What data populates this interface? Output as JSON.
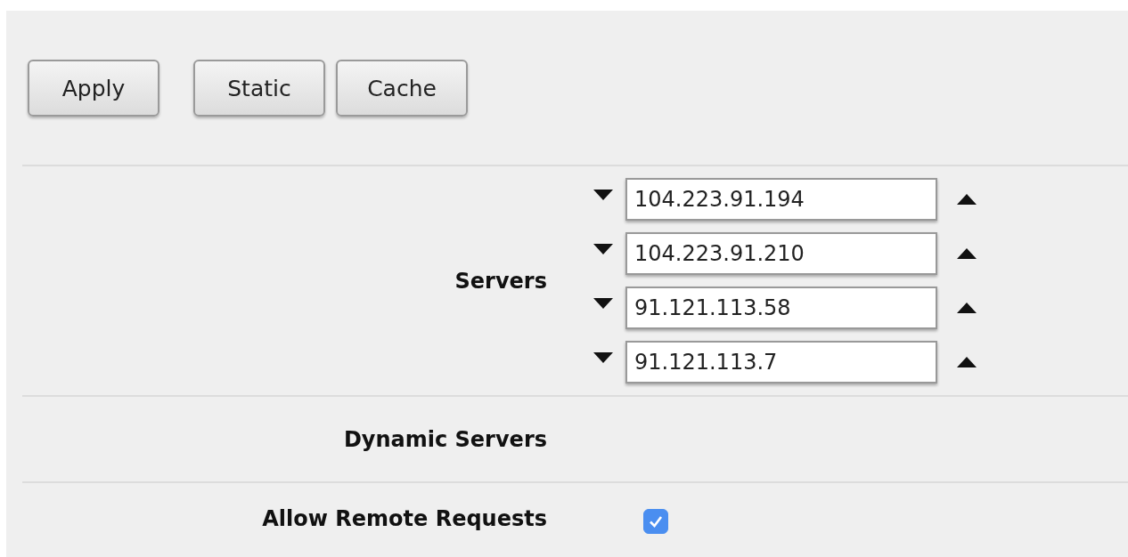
{
  "toolbar": {
    "groups": [
      {
        "buttons": [
          "Apply"
        ]
      },
      {
        "buttons": [
          "Static",
          "Cache"
        ]
      }
    ]
  },
  "settings": [
    {
      "kind": "list",
      "label": "Servers",
      "values": [
        "104.223.91.194",
        "104.223.91.210",
        "91.121.113.58",
        "91.121.113.7"
      ]
    },
    {
      "kind": "empty",
      "label": "Dynamic Servers"
    },
    {
      "kind": "checkbox",
      "label": "Allow Remote Requests",
      "checked": true
    }
  ]
}
